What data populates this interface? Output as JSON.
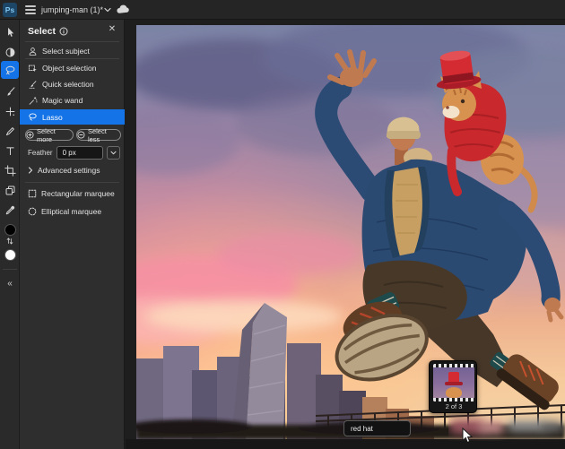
{
  "topbar": {
    "logo_text": "Ps",
    "document_title": "jumping-man (1)*"
  },
  "select_panel": {
    "title": "Select",
    "select_subject_label": "Select subject",
    "tool_items": [
      {
        "label": "Object selection"
      },
      {
        "label": "Quick selection"
      },
      {
        "label": "Magic wand"
      },
      {
        "label": "Lasso"
      }
    ],
    "active_tool_item": "Lasso",
    "select_more_label": "Select more",
    "select_less_label": "Select less",
    "feather_label": "Feather",
    "feather_value": "0 px",
    "advanced_settings_label": "Advanced settings",
    "marquee_items": [
      {
        "label": "Rectangular marquee"
      },
      {
        "label": "Elliptical marquee"
      }
    ]
  },
  "variations_card": {
    "caption": "2 of 3"
  },
  "prompt_bar": {
    "input_value": "red hat"
  },
  "colors": {
    "accent_blue": "#1473e6",
    "topbar_bg": "#252525",
    "toolbar_bg": "#2a2a2a",
    "panel_bg": "#2e2e2e",
    "canvas_bg": "#1e1e1e",
    "hat_red": "#d42b33",
    "jacket_navy": "#2b4a72"
  }
}
